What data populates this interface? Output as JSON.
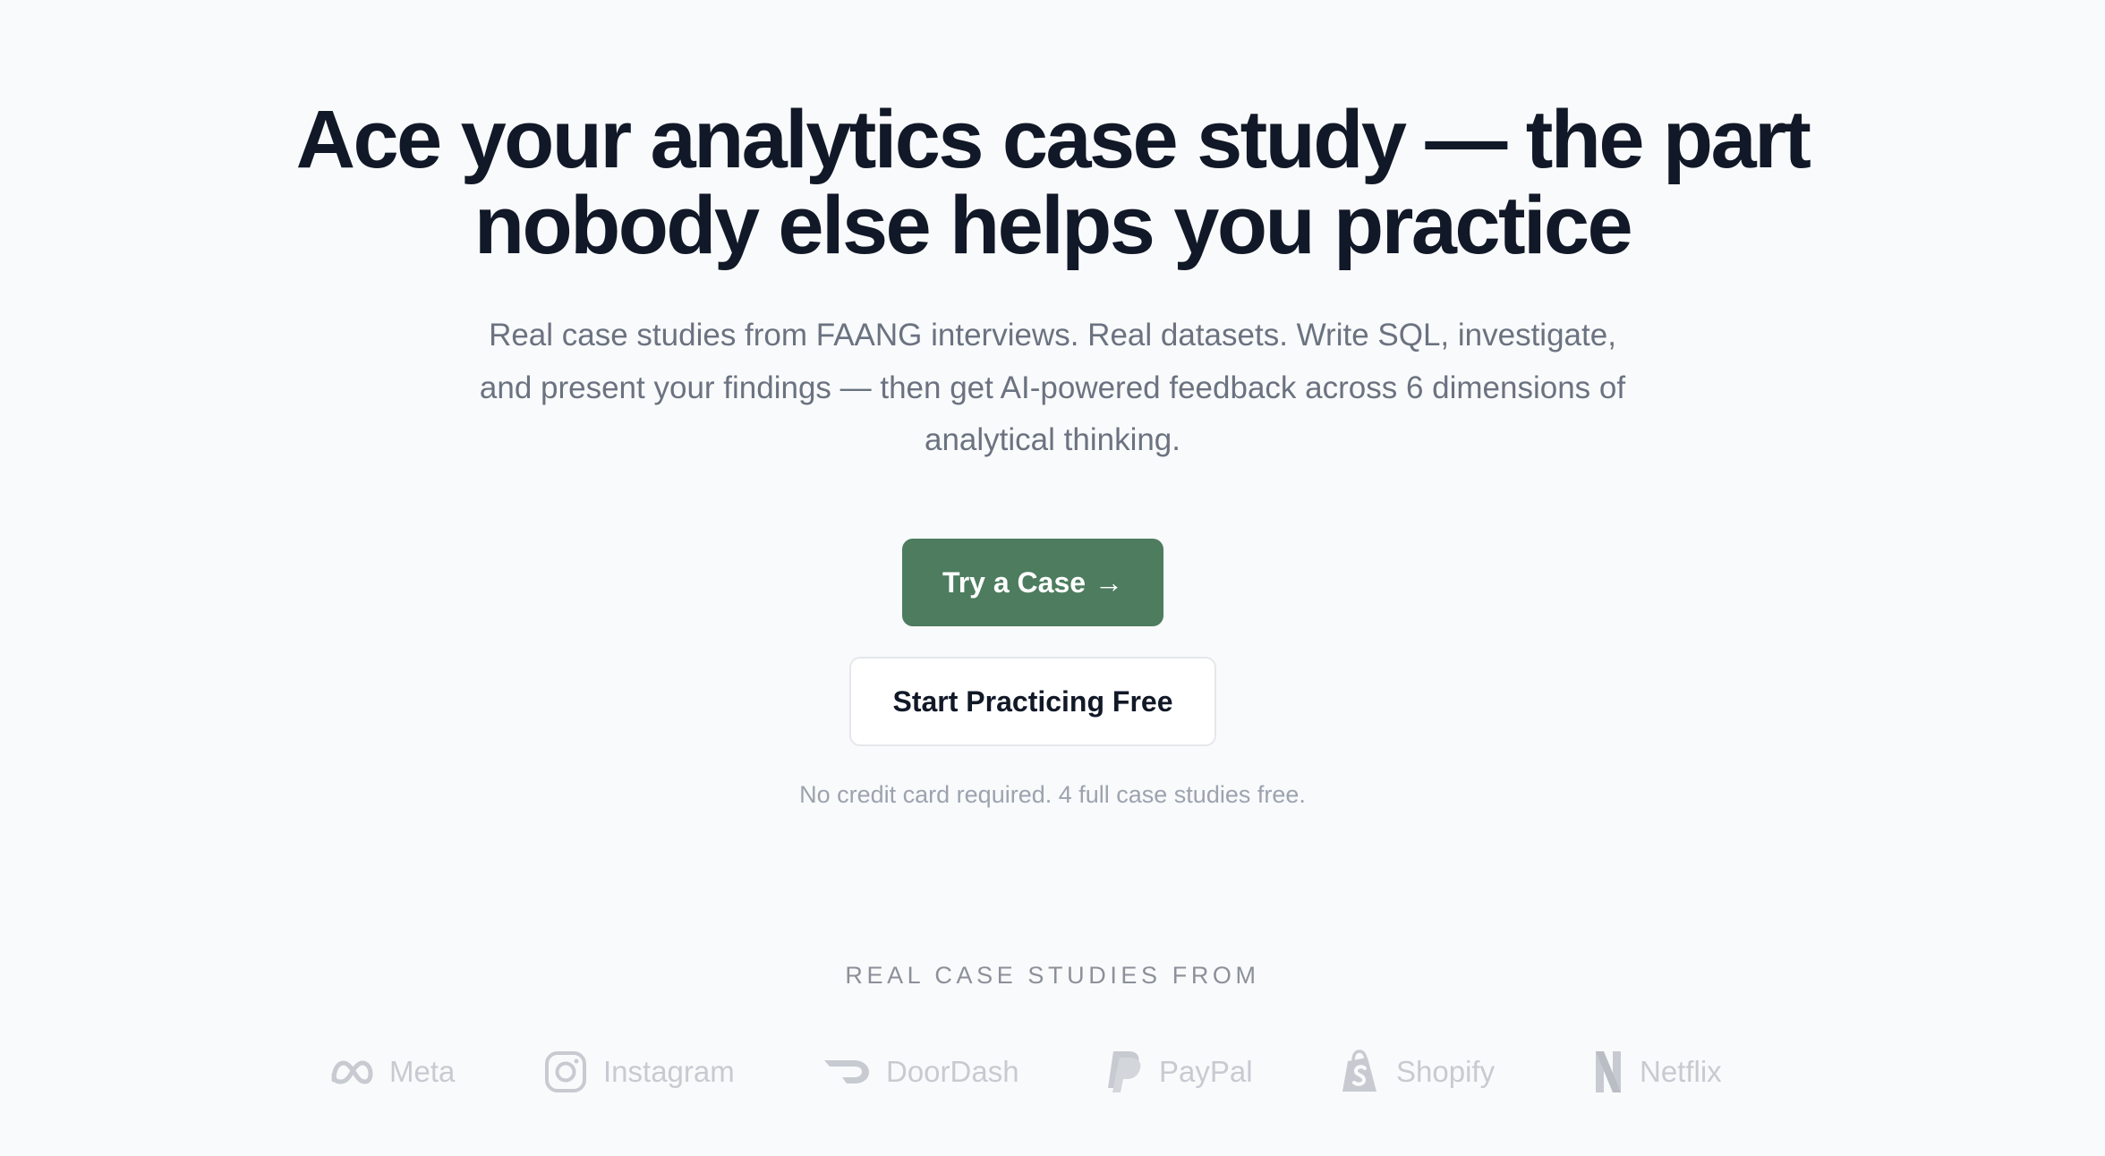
{
  "hero": {
    "headline_line1": "Ace your analytics case study — the part",
    "headline_line2": "nobody else helps you practice",
    "subtitle_line1": "Real case studies from FAANG interviews. Real datasets. Write SQL, investigate,",
    "subtitle_line2": "and present your findings — then get AI-powered feedback across 6 dimensions of",
    "subtitle_line3": "analytical thinking.",
    "primary_button": "Try a Case",
    "primary_button_arrow": "→",
    "secondary_button": "Start Practicing Free",
    "note": "No credit card required. 4 full case studies free."
  },
  "logos": {
    "heading": "REAL CASE STUDIES FROM",
    "items": [
      {
        "label": "Meta",
        "icon": "meta-icon"
      },
      {
        "label": "Instagram",
        "icon": "instagram-icon"
      },
      {
        "label": "DoorDash",
        "icon": "doordash-icon"
      },
      {
        "label": "PayPal",
        "icon": "paypal-icon"
      },
      {
        "label": "Shopify",
        "icon": "shopify-icon"
      },
      {
        "label": "Netflix",
        "icon": "netflix-icon"
      }
    ]
  },
  "colors": {
    "background": "#f9fafb",
    "headline": "#111827",
    "subtitle": "#6b7280",
    "primary_button": "#4d7c5f",
    "muted": "#9ca3af",
    "logo_gray": "#c7cbd1"
  }
}
